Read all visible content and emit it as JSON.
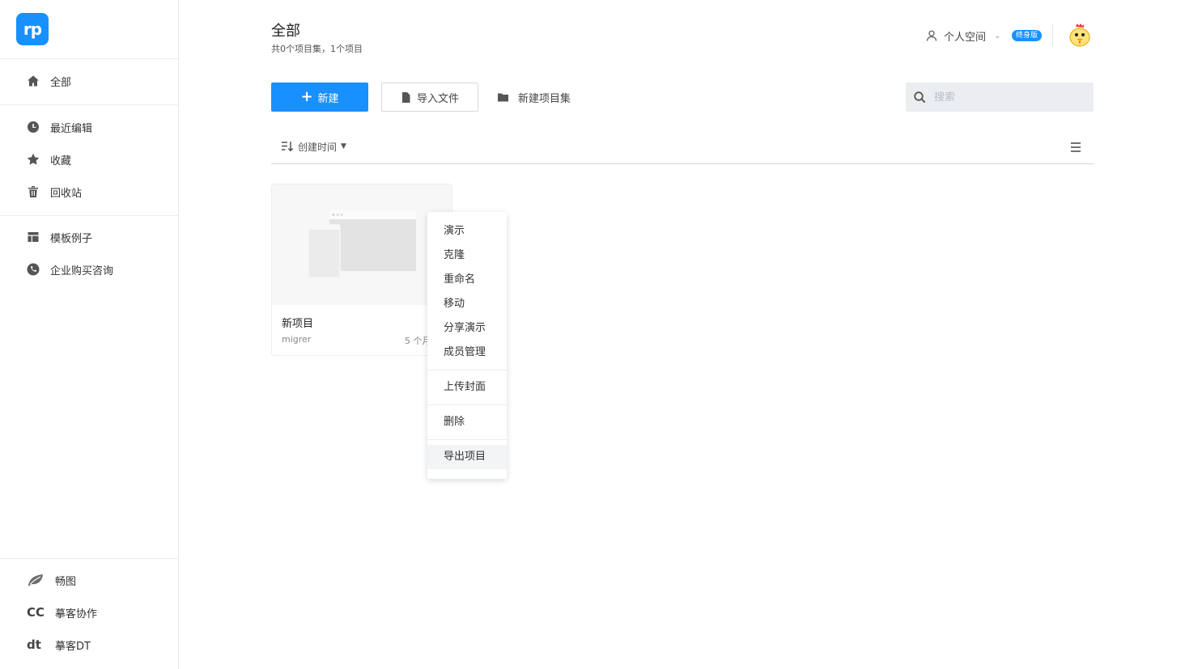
{
  "logo": {
    "text": "rp"
  },
  "sidebar": {
    "items": [
      {
        "label": "全部",
        "icon": "home-icon"
      },
      {
        "label": "最近编辑",
        "icon": "clock-icon"
      },
      {
        "label": "收藏",
        "icon": "star-icon"
      },
      {
        "label": "回收站",
        "icon": "trash-icon"
      },
      {
        "label": "模板例子",
        "icon": "template-icon"
      },
      {
        "label": "企业购买咨询",
        "icon": "phone-icon"
      }
    ],
    "products": [
      {
        "label": "畅图",
        "icon": "leaf-icon"
      },
      {
        "label": "摹客协作",
        "icon": "cc-icon",
        "glyph": "CC"
      },
      {
        "label": "摹客DT",
        "icon": "dt-icon",
        "glyph": "dt"
      }
    ]
  },
  "header": {
    "title": "全部",
    "subtitle": "共0个项目集，1个项目",
    "space_label": "个人空间",
    "badge": "终身版"
  },
  "toolbar": {
    "new_label": "新建",
    "import_label": "导入文件",
    "new_folder_label": "新建项目集",
    "search_placeholder": "搜索"
  },
  "sort": {
    "label": "创建时间"
  },
  "projects": [
    {
      "title": "新项目",
      "owner": "migrer",
      "time": "5 个月"
    }
  ],
  "context_menu": {
    "groups": [
      [
        "演示",
        "克隆",
        "重命名",
        "移动",
        "分享演示",
        "成员管理"
      ],
      [
        "上传封面"
      ],
      [
        "删除"
      ],
      [
        "导出项目"
      ]
    ],
    "hovered": "导出项目"
  },
  "colors": {
    "accent": "#1890ff",
    "search_bg": "#ebedf0"
  }
}
